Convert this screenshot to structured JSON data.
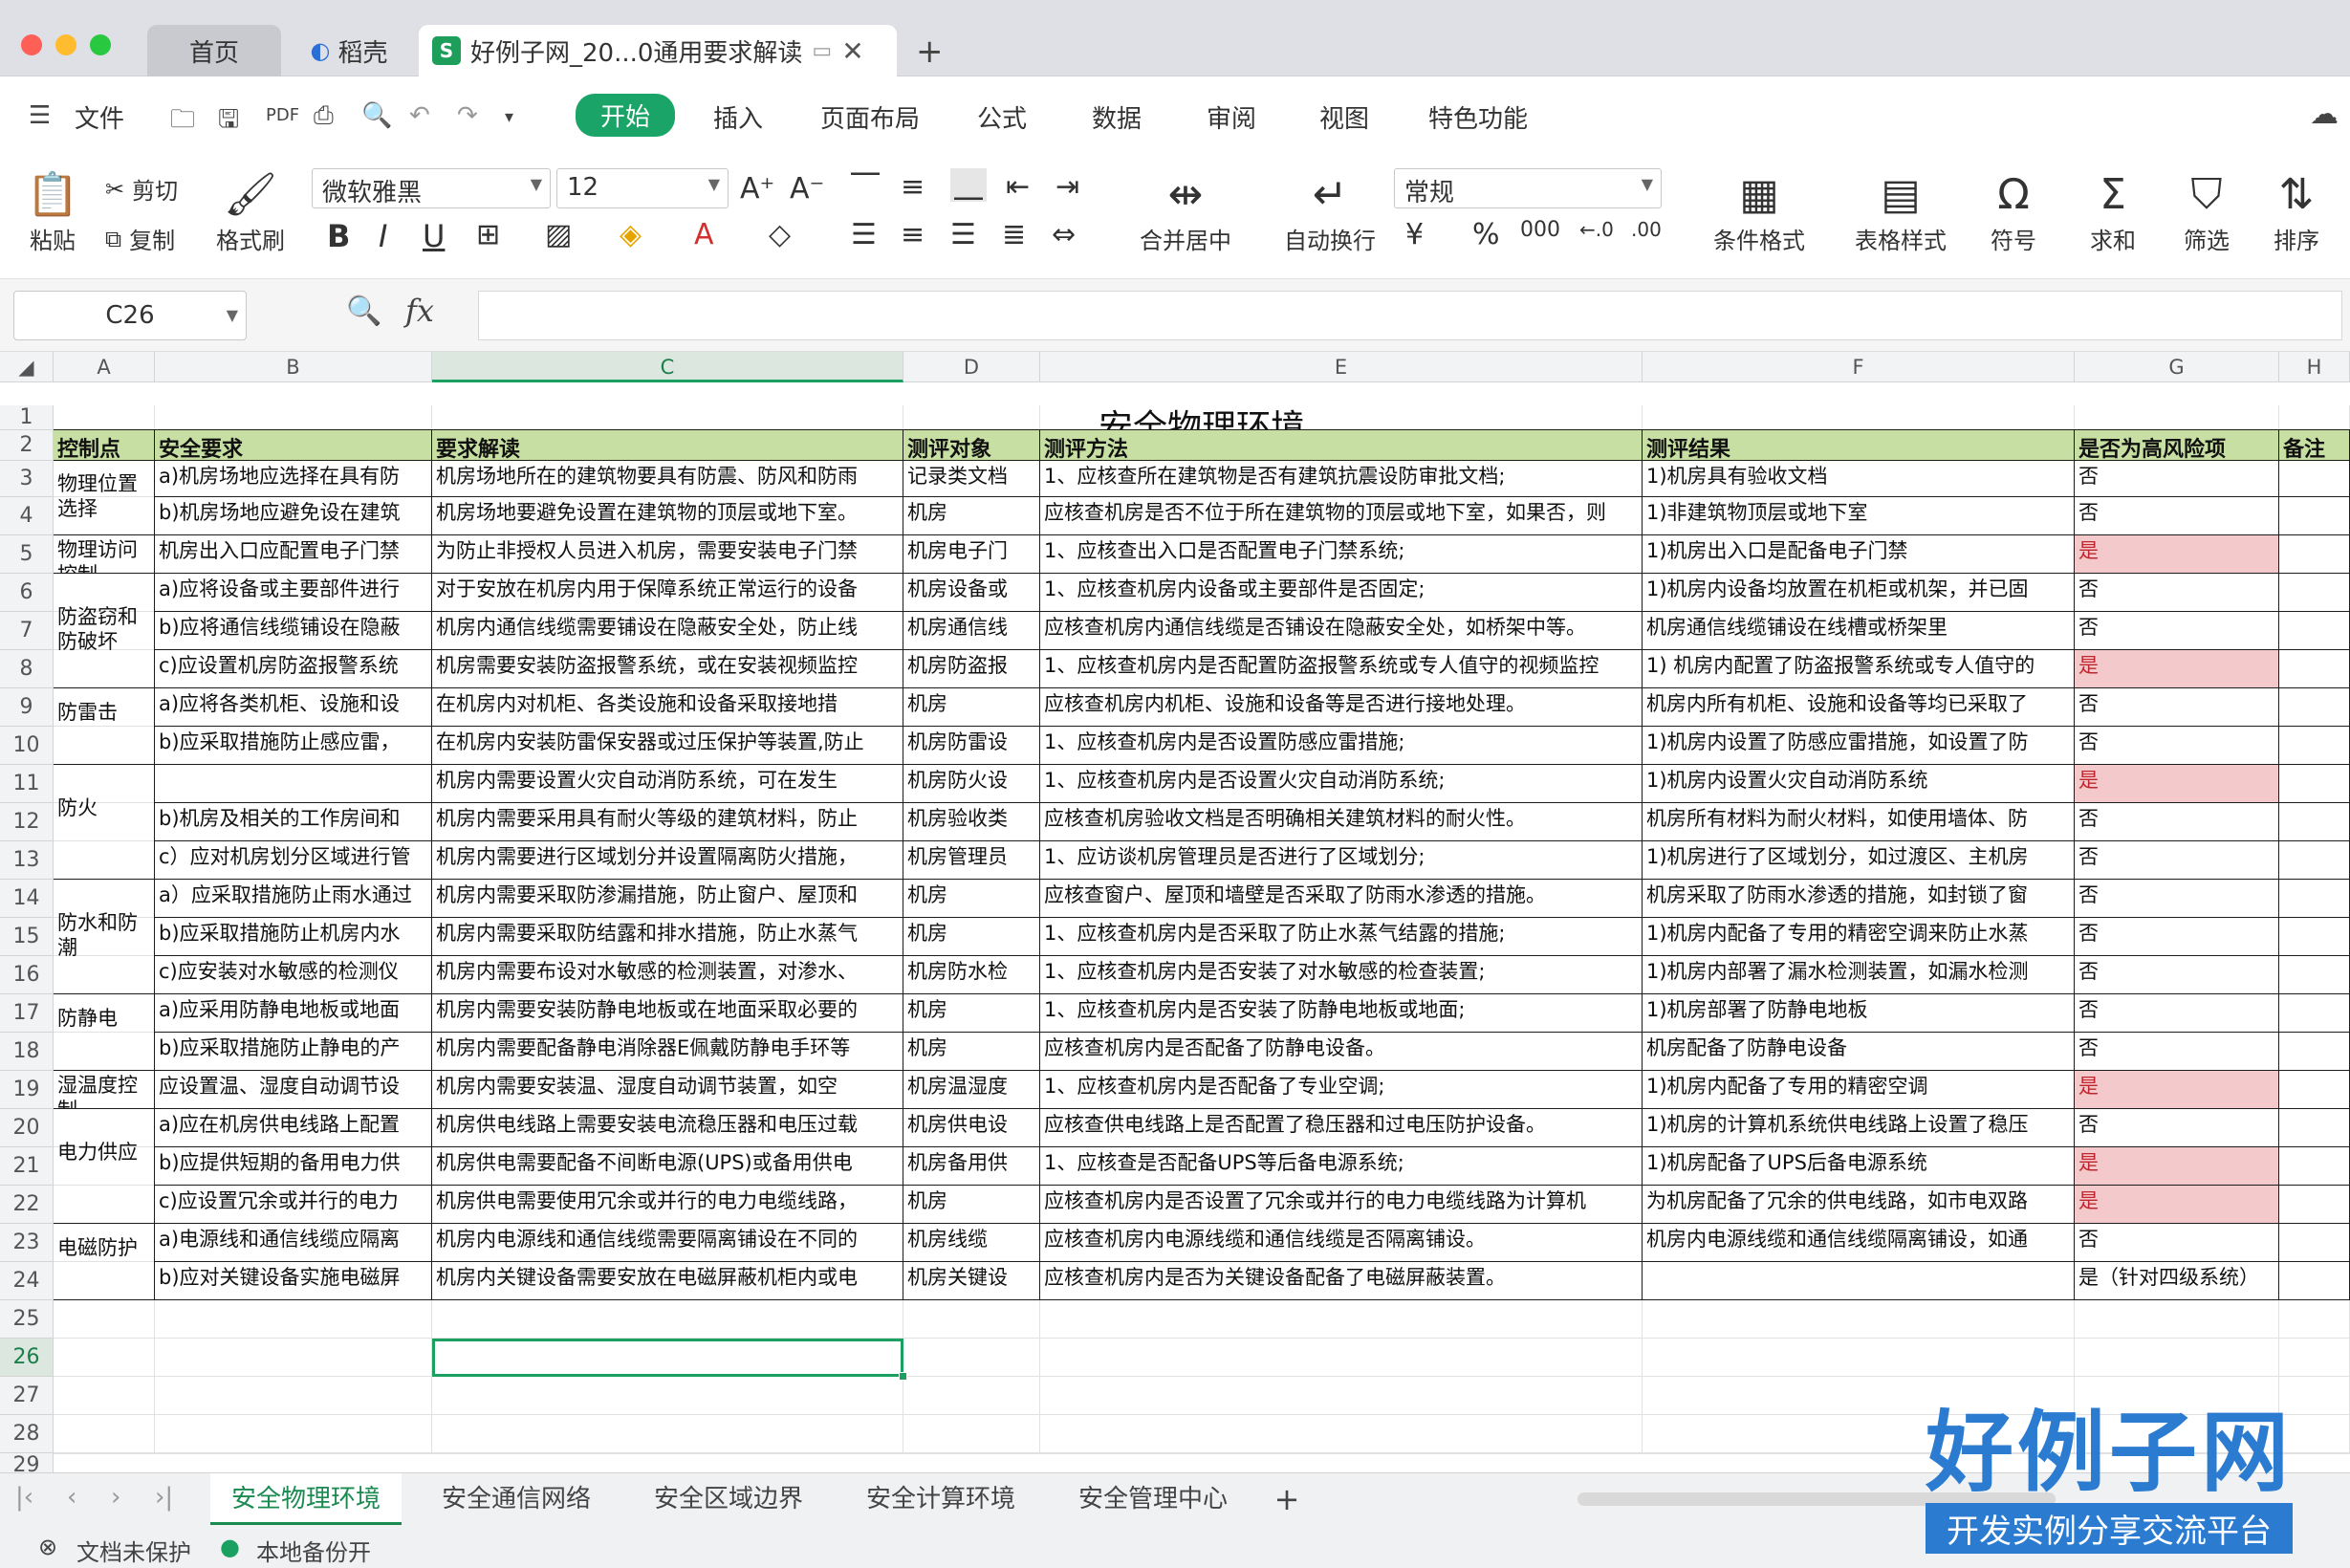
{
  "titlebar": {
    "tabs": [
      {
        "label": "首页"
      },
      {
        "label": "稻壳"
      },
      {
        "label": "好例子网_20...0通用要求解读"
      }
    ],
    "new_tab": "+"
  },
  "menu": {
    "file": "文件",
    "items": [
      "开始",
      "插入",
      "页面布局",
      "公式",
      "数据",
      "审阅",
      "视图",
      "特色功能"
    ]
  },
  "ribbon": {
    "paste": "粘贴",
    "cut": "剪切",
    "copy": "复制",
    "format_painter": "格式刷",
    "font_name": "微软雅黑",
    "font_size": "12",
    "number_format": "常规",
    "merge_center": "合并居中",
    "auto_wrap": "自动换行",
    "cond_format": "条件格式",
    "table_style": "表格样式",
    "symbol": "符号",
    "sum": "求和",
    "filter": "筛选",
    "sort": "排序"
  },
  "formula_bar": {
    "cell_ref": "C26",
    "fx": "fx",
    "value": ""
  },
  "columns": [
    "A",
    "B",
    "C",
    "D",
    "E",
    "F",
    "G",
    "H"
  ],
  "rows": [
    "1",
    "2",
    "3",
    "4",
    "5",
    "6",
    "7",
    "8",
    "9",
    "10",
    "11",
    "12",
    "13",
    "14",
    "15",
    "16",
    "17",
    "18",
    "19",
    "20",
    "21",
    "22",
    "23",
    "24",
    "25",
    "26",
    "27",
    "28",
    "29"
  ],
  "sheet": {
    "title": "安全物理环境",
    "headers": [
      "控制点",
      "安全要求",
      "要求解读",
      "测评对象",
      "测评方法",
      "测评结果",
      "是否为高风险项",
      "备注"
    ],
    "controls": [
      {
        "label": "物理位置选择"
      },
      {
        "label": "物理访问控制"
      },
      {
        "label": "防盗窃和防破坏"
      },
      {
        "label": "防雷击"
      },
      {
        "label": "防火"
      },
      {
        "label": "防水和防潮"
      },
      {
        "label": "防静电"
      },
      {
        "label": "湿温度控制"
      },
      {
        "label": "电力供应"
      },
      {
        "label": "电磁防护"
      }
    ],
    "data_rows": [
      {
        "b": "a)机房场地应选择在具有防",
        "c": "机房场地所在的建筑物要具有防震、防风和防雨",
        "d": "记录类文档",
        "e": "1、应核查所在建筑物是否有建筑抗震设防审批文档;",
        "f": "1)机房具有验收文档",
        "g": "否"
      },
      {
        "b": "b)机房场地应避免设在建筑",
        "c": "机房场地要避免设置在建筑物的顶层或地下室。",
        "d": "机房",
        "e": "应核查机房是否不位于所在建筑物的顶层或地下室，如果否，则",
        "f": "1)非建筑物顶层或地下室",
        "g": "否"
      },
      {
        "b": "机房出入口应配置电子门禁",
        "c": "为防止非授权人员进入机房，需要安装电子门禁",
        "d": "机房电子门",
        "e": "1、应核查出入口是否配置电子门禁系统;",
        "f": "1)机房出入口是配备电子门禁",
        "g": "是"
      },
      {
        "b": "a)应将设备或主要部件进行",
        "c": "对于安放在机房内用于保障系统正常运行的设备",
        "d": "机房设备或",
        "e": "1、应核查机房内设备或主要部件是否固定;",
        "f": "1)机房内设备均放置在机柜或机架，并已固",
        "g": "否"
      },
      {
        "b": "b)应将通信线缆铺设在隐蔽",
        "c": "机房内通信线缆需要铺设在隐蔽安全处，防止线",
        "d": "机房通信线",
        "e": "应核查机房内通信线缆是否铺设在隐蔽安全处，如桥架中等。",
        "f": "机房通信线缆铺设在线槽或桥架里",
        "g": "否"
      },
      {
        "b": "c)应设置机房防盗报警系统",
        "c": "机房需要安装防盗报警系统，或在安装视频监控",
        "d": "机房防盗报",
        "e": "1、应核查机房内是否配置防盗报警系统或专人值守的视频监控",
        "f": "1) 机房内配置了防盗报警系统或专人值守的",
        "g": "是"
      },
      {
        "b": "a)应将各类机柜、设施和设",
        "c": "在机房内对机柜、各类设施和设备采取接地措",
        "d": "机房",
        "e": "应核查机房内机柜、设施和设备等是否进行接地处理。",
        "f": "机房内所有机柜、设施和设备等均已采取了",
        "g": "否"
      },
      {
        "b": " b)应采取措施防止感应雷，",
        "c": "在机房内安装防雷保安器或过压保护等装置,防止",
        "d": "机房防雷设",
        "e": "1、应核查机房内是否设置防感应雷措施;",
        "f": "1)机房内设置了防感应雷措施，如设置了防",
        "g": "否"
      },
      {
        "b": "",
        "c": " 机房内需要设置火灾自动消防系统，可在发生",
        "d": "机房防火设",
        "e": "1、应核查机房内是否设置火灾自动消防系统;",
        "f": "1)机房内设置火灾自动消防系统",
        "g": "是"
      },
      {
        "b": "b)机房及相关的工作房间和",
        "c": "机房内需要采用具有耐火等级的建筑材料，防止",
        "d": "机房验收类",
        "e": "应核查机房验收文档是否明确相关建筑材料的耐火性。",
        "f": "机房所有材料为耐火材料，如使用墙体、防",
        "g": "否"
      },
      {
        "b": "c）应对机房划分区域进行管",
        "c": "机房内需要进行区域划分并设置隔离防火措施，",
        "d": "机房管理员",
        "e": "1、应访谈机房管理员是否进行了区域划分;",
        "f": "1)机房进行了区域划分，如过渡区、主机房",
        "g": "否"
      },
      {
        "b": "a）应采取措施防止雨水通过",
        "c": "机房内需要采取防渗漏措施，防止窗户、屋顶和",
        "d": "机房",
        "e": "应核查窗户、屋顶和墙壁是否采取了防雨水渗透的措施。",
        "f": "机房采取了防雨水渗透的措施，如封锁了窗",
        "g": "否"
      },
      {
        "b": "b)应采取措施防止机房内水",
        "c": "机房内需要采取防结露和排水措施，防止水蒸气",
        "d": "机房",
        "e": "1、应核查机房内是否采取了防止水蒸气结露的措施;",
        "f": "1)机房内配备了专用的精密空调来防止水蒸",
        "g": "否"
      },
      {
        "b": "c)应安装对水敏感的检测仪",
        "c": "机房内需要布设对水敏感的检测装置，对渗水、",
        "d": "机房防水检",
        "e": "1、应核查机房内是否安装了对水敏感的检查装置;",
        "f": "1)机房内部署了漏水检测装置，如漏水检测",
        "g": "否"
      },
      {
        "b": "a)应采用防静电地板或地面",
        "c": "机房内需要安装防静电地板或在地面采取必要的",
        "d": "机房",
        "e": "1、应核查机房内是否安装了防静电地板或地面;",
        "f": "1)机房部署了防静电地板",
        "g": "否"
      },
      {
        "b": "b)应采取措施防止静电的产",
        "c": "机房内需要配备静电消除器E佩戴防静电手环等",
        "d": "机房",
        "e": "应核查机房内是否配备了防静电设备。",
        "f": "机房配备了防静电设备",
        "g": "否"
      },
      {
        "b": "应设置温、湿度自动调节设",
        "c": " 机房内需要安装温、湿度自动调节装置，如空",
        "d": "机房温湿度",
        "e": "1、应核查机房内是否配备了专业空调;",
        "f": "1)机房内配备了专用的精密空调",
        "g": "是"
      },
      {
        "b": "a)应在机房供电线路上配置",
        "c": "机房供电线路上需要安装电流稳压器和电压过载",
        "d": "机房供电设",
        "e": "应核查供电线路上是否配置了稳压器和过电压防护设备。",
        "f": "1)机房的计算机系统供电线路上设置了稳压",
        "g": "否"
      },
      {
        "b": "b)应提供短期的备用电力供",
        "c": "机房供电需要配备不间断电源(UPS)或备用供电",
        "d": "机房备用供",
        "e": "1、应核查是否配备UPS等后备电源系统;",
        "f": "1)机房配备了UPS后备电源系统",
        "g": "是"
      },
      {
        "b": "c)应设置冗余或并行的电力",
        "c": "机房供电需要使用冗余或并行的电力电缆线路，",
        "d": "机房",
        "e": "应核查机房内是否设置了冗余或并行的电力电缆线路为计算机",
        "f": "为机房配备了冗余的供电线路，如市电双路",
        "g": "是"
      },
      {
        "b": "a)电源线和通信线缆应隔离",
        "c": "机房内电源线和通信线缆需要隔离铺设在不同的",
        "d": "机房线缆",
        "e": "应核查机房内电源线缆和通信线缆是否隔离铺设。",
        "f": "机房内电源线缆和通信线缆隔离铺设，如通",
        "g": "否"
      },
      {
        "b": "b)应对关键设备实施电磁屏",
        "c": "机房内关键设备需要安放在电磁屏蔽机柜内或电",
        "d": "机房关键设",
        "e": "应核查机房内是否为关键设备配备了电磁屏蔽装置。",
        "f": "",
        "g": "是（针对四级系统）"
      }
    ]
  },
  "sheet_tabs": [
    "安全物理环境",
    "安全通信网络",
    "安全区域边界",
    "安全计算环境",
    "安全管理中心",
    "+"
  ],
  "status": {
    "protect": "文档未保护",
    "backup": "本地备份开"
  },
  "watermark": {
    "title": "好例子网",
    "subtitle": "开发实例分享交流平台"
  },
  "colors": {
    "accent": "#1aa162",
    "header_fill": "#c8dfa3",
    "risk_fill": "#f4c9cc",
    "risk_text": "#c0262d"
  }
}
